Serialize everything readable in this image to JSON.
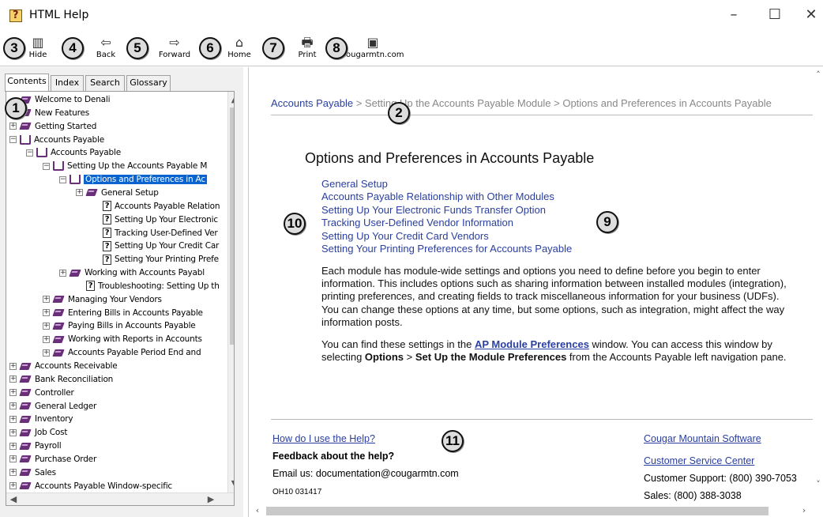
{
  "window": {
    "title": "HTML Help",
    "minimize": "–",
    "maximize": "☐",
    "close": "✕"
  },
  "toolbar": {
    "hide": "Hide",
    "back": "Back",
    "forward": "Forward",
    "home": "Home",
    "print": "Print",
    "site": "cougarmtn.com",
    "icons": {
      "back": "⇦",
      "forward": "⇨",
      "home": "⌂",
      "print": "🖶",
      "site": "▣",
      "hide": "▥"
    }
  },
  "callouts": [
    "1",
    "2",
    "3",
    "4",
    "5",
    "6",
    "7",
    "8",
    "9",
    "10",
    "11"
  ],
  "tabs": [
    "Contents",
    "Index",
    "Search",
    "Glossary"
  ],
  "tree": [
    {
      "label": "Welcome to Denali",
      "icon": "book",
      "exp": "",
      "level": 0
    },
    {
      "label": "New Features",
      "icon": "book",
      "exp": "",
      "level": 0
    },
    {
      "label": "Getting Started",
      "icon": "book",
      "exp": "+",
      "level": 0
    },
    {
      "label": "Accounts Payable",
      "icon": "open",
      "exp": "−",
      "level": 0
    },
    {
      "label": "Accounts Payable",
      "icon": "open",
      "exp": "−",
      "level": 1
    },
    {
      "label": "Setting Up the Accounts Payable M",
      "icon": "open",
      "exp": "−",
      "level": 2
    },
    {
      "label": "Options and Preferences in Ac",
      "icon": "open",
      "exp": "−",
      "level": 3,
      "selected": true
    },
    {
      "label": "General Setup",
      "icon": "book",
      "exp": "+",
      "level": 4
    },
    {
      "label": "Accounts Payable Relation",
      "icon": "q",
      "exp": "",
      "level": 5
    },
    {
      "label": "Setting Up Your Electronic",
      "icon": "q",
      "exp": "",
      "level": 5
    },
    {
      "label": "Tracking User-Defined Ver",
      "icon": "q",
      "exp": "",
      "level": 5
    },
    {
      "label": "Setting Up Your Credit Car",
      "icon": "q",
      "exp": "",
      "level": 5
    },
    {
      "label": "Setting Your Printing Prefe",
      "icon": "q",
      "exp": "",
      "level": 5
    },
    {
      "label": "Working with Accounts Payabl",
      "icon": "book",
      "exp": "+",
      "level": 3
    },
    {
      "label": "Troubleshooting: Setting Up th",
      "icon": "q",
      "exp": "",
      "level": 4
    },
    {
      "label": "Managing Your Vendors",
      "icon": "book",
      "exp": "+",
      "level": 2
    },
    {
      "label": "Entering Bills in Accounts Payable",
      "icon": "book",
      "exp": "+",
      "level": 2
    },
    {
      "label": "Paying Bills in Accounts Payable",
      "icon": "book",
      "exp": "+",
      "level": 2
    },
    {
      "label": "Working with Reports in Accounts",
      "icon": "book",
      "exp": "+",
      "level": 2
    },
    {
      "label": "Accounts Payable Period End and",
      "icon": "book",
      "exp": "+",
      "level": 2
    },
    {
      "label": "Accounts Receivable",
      "icon": "book",
      "exp": "+",
      "level": 0
    },
    {
      "label": "Bank Reconciliation",
      "icon": "book",
      "exp": "+",
      "level": 0
    },
    {
      "label": "Controller",
      "icon": "book",
      "exp": "+",
      "level": 0
    },
    {
      "label": "General Ledger",
      "icon": "book",
      "exp": "+",
      "level": 0
    },
    {
      "label": "Inventory",
      "icon": "book",
      "exp": "+",
      "level": 0
    },
    {
      "label": "Job Cost",
      "icon": "book",
      "exp": "+",
      "level": 0
    },
    {
      "label": "Payroll",
      "icon": "book",
      "exp": "+",
      "level": 0
    },
    {
      "label": "Purchase Order",
      "icon": "book",
      "exp": "+",
      "level": 0
    },
    {
      "label": "Sales",
      "icon": "book",
      "exp": "+",
      "level": 0
    },
    {
      "label": "Accounts Payable Window-specific",
      "icon": "book",
      "exp": "+",
      "level": 0
    }
  ],
  "content": {
    "breadcrumb": {
      "part1": "Accounts Payable",
      "sep1": " > ",
      "part2": "Setting Up the Accounts Payable Module",
      "sep2": " > ",
      "part3": "Options and Preferences in Accounts Payable"
    },
    "title": "Options and Preferences in Accounts Payable",
    "links": [
      "General Setup",
      "Accounts Payable Relationship with Other Modules",
      "Setting Up Your Electronic Funds Transfer Option",
      "Tracking User-Defined Vendor Information",
      "Setting Up Your Credit Card Vendors",
      "Setting Your Printing Preferences for Accounts Payable"
    ],
    "para1": "Each module has module-wide settings and options you need to define before you begin to enter information. This includes options such as sharing information between installed modules (integration), printing preferences, and creating fields to track miscellaneous information for your business (UDFs). You can change these options at any time, but some options, such as integration, might affect the way information posts.",
    "para2": {
      "pre": "You can find these settings in the ",
      "link": "AP Module Preferences",
      "mid": " window. You can access this window by selecting ",
      "b1": "Options",
      "gt": " > ",
      "b2": "Set Up the Module Preferences",
      "post": " from the Accounts Payable left navigation pane."
    }
  },
  "footer": {
    "howto": "How do I use the Help?",
    "feedback": "Feedback about the help?",
    "email": "Email us: documentation@cougarmtn.com",
    "code": "OH10 031417",
    "company": "Cougar Mountain Software",
    "service": "Customer Service Center",
    "support": "Customer Support: (800) 390-7053",
    "sales": "Sales: (800) 388-3038"
  }
}
